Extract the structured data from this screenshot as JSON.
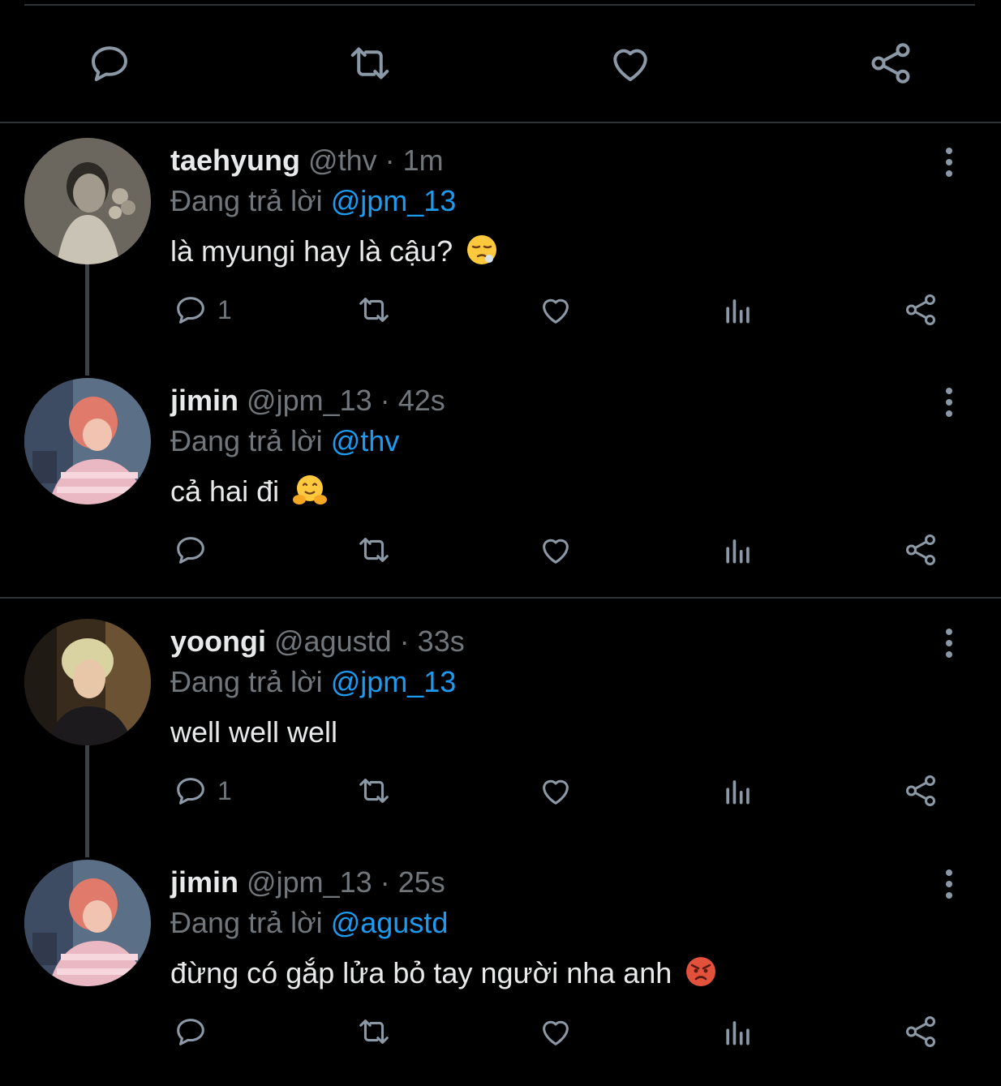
{
  "main_actions": [
    {
      "name": "reply-icon"
    },
    {
      "name": "retweet-icon"
    },
    {
      "name": "like-icon"
    },
    {
      "name": "share-icon"
    }
  ],
  "tweets": [
    {
      "name": "taehyung",
      "handle": "@thv",
      "dot": "·",
      "time": "1m",
      "reply_prefix": "Đang trả lời",
      "reply_to": "@jpm_13",
      "text": "là myungi hay là cậu?",
      "emoji": "pensive-face",
      "reply_count": "1"
    },
    {
      "name": "jimin",
      "handle": "@jpm_13",
      "dot": "·",
      "time": "42s",
      "reply_prefix": "Đang trả lời",
      "reply_to": "@thv",
      "text": "cả hai đi",
      "emoji": "hugging-face",
      "reply_count": ""
    },
    {
      "name": "yoongi",
      "handle": "@agustd",
      "dot": "·",
      "time": "33s",
      "reply_prefix": "Đang trả lời",
      "reply_to": "@jpm_13",
      "text": "well well well",
      "emoji": "",
      "reply_count": "1"
    },
    {
      "name": "jimin",
      "handle": "@jpm_13",
      "dot": "·",
      "time": "25s",
      "reply_prefix": "Đang trả lời",
      "reply_to": "@agustd",
      "text": "đừng có gắp lửa bỏ tay người nha anh",
      "emoji": "angry-face",
      "reply_count": ""
    }
  ],
  "colors": {
    "background": "#000000",
    "text": "#e7e9ea",
    "muted": "#71767b",
    "mention": "#1d9bf0",
    "divider": "#2f3336"
  }
}
